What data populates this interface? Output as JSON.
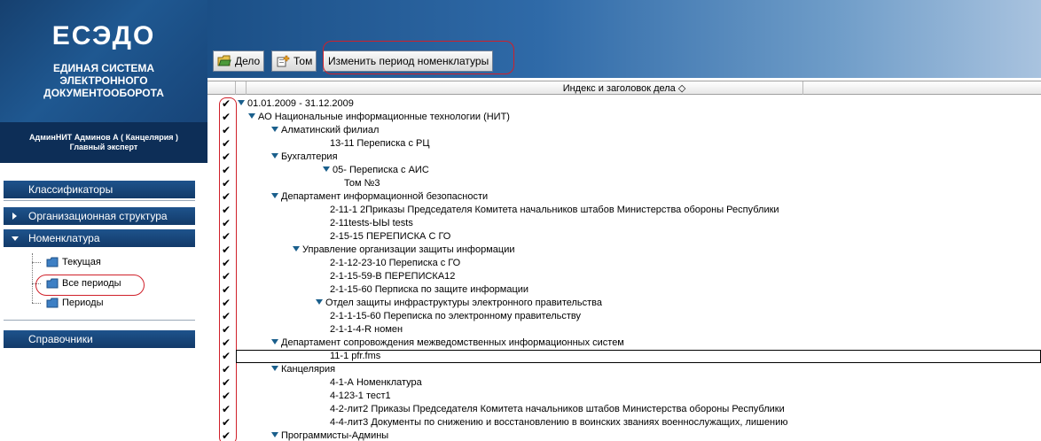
{
  "logo": {
    "title": "ЕСЭДО",
    "subtitle": "ЕДИНАЯ СИСТЕМА ЭЛЕКТРОННОГО ДОКУМЕНТООБОРОТА"
  },
  "user": {
    "name": "АдминНИТ Админов А ( Канцелярия )",
    "role": "Главный эксперт"
  },
  "sidebar": {
    "classifiers": "Классификаторы",
    "org_structure": "Организационная структура",
    "nomenclature": "Номенклатура",
    "sub_items": [
      "Текущая",
      "Все периоды",
      "Периоды"
    ],
    "references": "Справочники"
  },
  "toolbar": {
    "delo": "Дело",
    "tom": "Том",
    "change_period": "Изменить период номенклатуры"
  },
  "grid": {
    "column_title": "Индекс и заголовок дела ◇",
    "rows": [
      "01.01.2009 - 31.12.2009",
      "АО Национальные информационные технологии (НИТ)",
      "Алматинский филиал",
      "13-11   Переписка с РЦ",
      "Бухгалтерия",
      "05-   Переписка с АИС",
      "Том №3",
      "Департамент информационной безопасности",
      "2-11-1   2Приказы  Председателя Комитета  начальников штабов  Министерства обороны  Республики",
      "2-11tests-ЫЫ   tests",
      "2-15-15   ПЕРЕПИСКА С ГО",
      "Управление организации защиты информации",
      "2-1-12-23-10   Переписка с ГО",
      "2-1-15-59-В   ПЕРЕПИСКА12",
      "2-1-15-60   Перписка по защите информации",
      "Отдел защиты инфраструктуры электронного правительства",
      "2-1-1-15-60   Переписка по электронному правительству",
      "2-1-1-4-R   номен",
      "Департамент сопровождения межведомственных информационных систем",
      "11-1   pfr.fms",
      "Канцелярия",
      "4-1-А   Номенклатура",
      "4-123-1   тест1",
      "4-2-лит2   Приказы  Председателя Комитета  начальников штабов  Министерства обороны  Республики",
      "4-4-лит3   Документы по снижению и  восстановлению в воинских званиях военнослужащих, лишению",
      "Программисты-Админы"
    ],
    "check_mark": "✔"
  }
}
